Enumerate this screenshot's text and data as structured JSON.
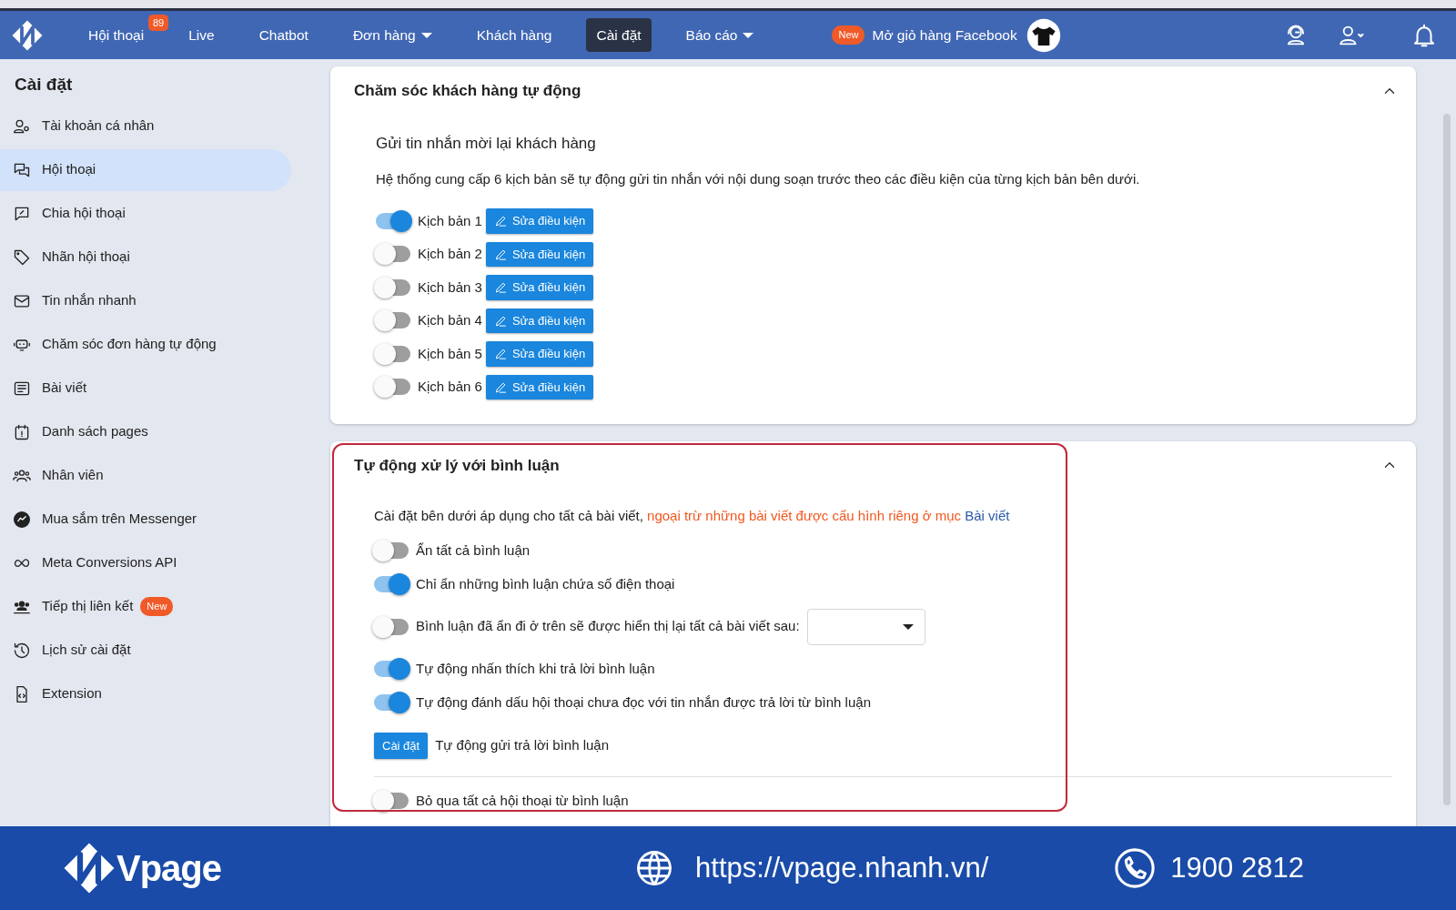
{
  "navbar": {
    "tabs": [
      {
        "label": "Hội thoại",
        "badge": "89",
        "dropdown": false,
        "selected": false
      },
      {
        "label": "Live",
        "dropdown": false,
        "selected": false
      },
      {
        "label": "Chatbot",
        "dropdown": false,
        "selected": false
      },
      {
        "label": "Đơn hàng",
        "dropdown": true,
        "selected": false
      },
      {
        "label": "Khách hàng",
        "dropdown": false,
        "selected": false
      },
      {
        "label": "Cài đặt",
        "dropdown": false,
        "selected": true
      },
      {
        "label": "Báo cáo",
        "dropdown": true,
        "selected": false
      }
    ],
    "promo": {
      "badge": "New",
      "label": "Mở giỏ hàng Facebook"
    }
  },
  "sidebar": {
    "title": "Cài đặt",
    "items": [
      {
        "label": "Tài khoản cá nhân",
        "selected": false
      },
      {
        "label": "Hội thoại",
        "selected": true
      },
      {
        "label": "Chia hội thoại",
        "selected": false
      },
      {
        "label": "Nhãn hội thoại",
        "selected": false
      },
      {
        "label": "Tin nhắn nhanh",
        "selected": false
      },
      {
        "label": "Chăm sóc đơn hàng tự động",
        "selected": false
      },
      {
        "label": "Bài viết",
        "selected": false
      },
      {
        "label": "Danh sách pages",
        "selected": false
      },
      {
        "label": "Nhân viên",
        "selected": false
      },
      {
        "label": "Mua sắm trên Messenger",
        "selected": false
      },
      {
        "label": "Meta Conversions API",
        "selected": false
      },
      {
        "label": "Tiếp thị liên kết",
        "badge": "New",
        "selected": false
      },
      {
        "label": "Lịch sử cài đặt",
        "selected": false
      },
      {
        "label": "Extension",
        "selected": false
      }
    ]
  },
  "auto_care": {
    "title": "Chăm sóc khách hàng tự động",
    "expanded": true,
    "subtitle": "Gửi tin nhắn mời lại khách hàng",
    "description": "Hệ thống cung cấp 6 kịch bản sẽ tự động gửi tin nhắn với nội dung soạn trước theo các điều kiện của từng kịch bản bên dưới.",
    "scripts": [
      {
        "label": "Kịch bản 1",
        "checked": true,
        "button": "Sửa điều kiện"
      },
      {
        "label": "Kịch bản 2",
        "checked": false,
        "button": "Sửa điều kiện"
      },
      {
        "label": "Kịch bản 3",
        "checked": false,
        "button": "Sửa điều kiện"
      },
      {
        "label": "Kịch bản 4",
        "checked": false,
        "button": "Sửa điều kiện"
      },
      {
        "label": "Kịch bản 5",
        "checked": false,
        "button": "Sửa điều kiện"
      },
      {
        "label": "Kịch bản 6",
        "checked": false,
        "button": "Sửa điều kiện"
      }
    ]
  },
  "comment_handling": {
    "title": "Tự động xử lý với bình luận",
    "expanded": true,
    "note": {
      "text": "Cài đặt bên dưới áp dụng cho tất cả bài viết,",
      "exception": "ngoại trừ những bài viết được cấu hình riêng ở mục",
      "link": "Bài viết"
    },
    "settings": [
      {
        "kind": "toggle",
        "label": "Ẩn tất cả bình luận",
        "checked": false
      },
      {
        "kind": "toggle",
        "label": "Chỉ ẩn những bình luận chứa số điện thoại",
        "checked": true
      },
      {
        "kind": "toggle_select",
        "label": "Bình luận đã ẩn đi ở trên sẽ được hiển thị lại tất cả bài viết sau:",
        "checked": false
      },
      {
        "kind": "toggle",
        "label": "Tự động nhấn thích khi trả lời bình luận",
        "checked": true
      },
      {
        "kind": "toggle",
        "label": "Tự động đánh dấu hội thoại chưa đọc với tin nhắn được trả lời từ bình luận",
        "checked": true
      },
      {
        "kind": "button",
        "button": "Cài đặt",
        "label": "Tự động gửi trả lời bình luận"
      },
      {
        "kind": "divider"
      },
      {
        "kind": "toggle",
        "label": "Bỏ qua tất cả hội thoại từ bình luận",
        "checked": false
      }
    ]
  },
  "footer": {
    "brand": "Vpage",
    "url": "https://vpage.nhanh.vn/",
    "phone": "1900 2812"
  }
}
